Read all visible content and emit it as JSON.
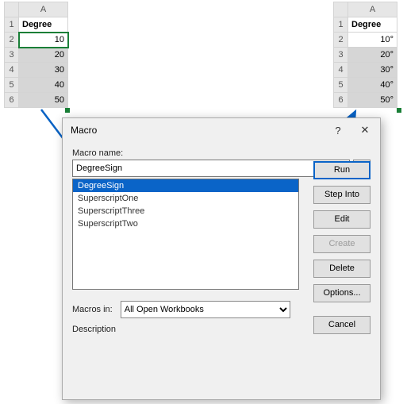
{
  "left_grid": {
    "col": "A",
    "header": "Degree",
    "rows": [
      "10",
      "20",
      "30",
      "40",
      "50"
    ]
  },
  "right_grid": {
    "col": "A",
    "header": "Degree",
    "rows": [
      "10°",
      "20°",
      "30°",
      "40°",
      "50°"
    ]
  },
  "dialog": {
    "title": "Macro",
    "help_glyph": "?",
    "close_glyph": "✕",
    "name_label": "Macro name:",
    "ref_glyph": "↥",
    "name_value": "DegreeSign",
    "macros": [
      "DegreeSign",
      "SuperscriptOne",
      "SuperscriptThree",
      "SuperscriptTwo"
    ],
    "buttons": {
      "run": "Run",
      "step": "Step Into",
      "edit": "Edit",
      "create": "Create",
      "delete": "Delete",
      "options": "Options..."
    },
    "macros_in_label": "Macros in:",
    "macros_in_value": "All Open Workbooks",
    "description_label": "Description",
    "cancel": "Cancel"
  }
}
